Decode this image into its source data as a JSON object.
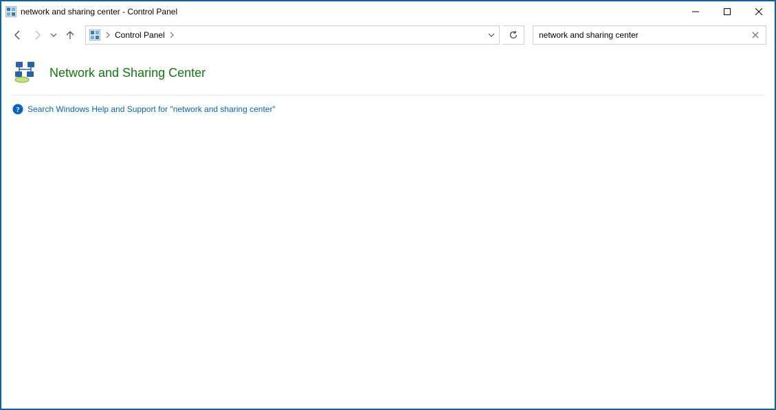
{
  "window": {
    "title": "network and sharing center - Control Panel"
  },
  "breadcrumb": {
    "root": "Control Panel"
  },
  "search": {
    "value": "network and sharing center"
  },
  "main": {
    "heading": "Network and Sharing Center",
    "help_link": "Search Windows Help and Support for \"network and sharing center\""
  }
}
